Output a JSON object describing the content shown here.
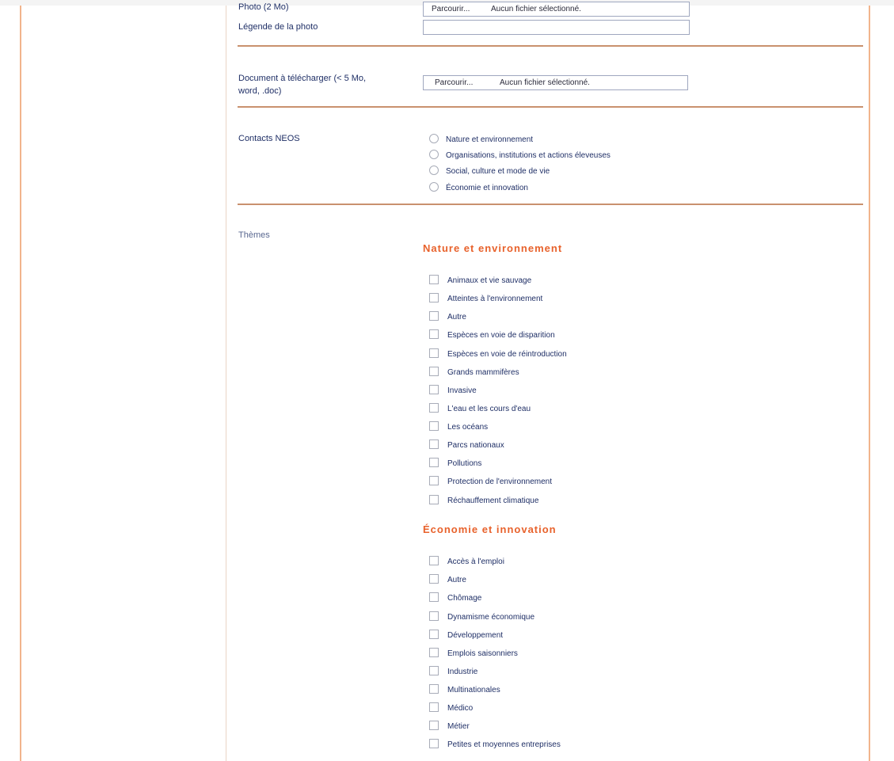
{
  "form": {
    "photo_label": "Photo (2 Mo)",
    "photo_browse": "Parcourir...",
    "photo_nofile": "Aucun fichier sélectionné.",
    "caption_label": "Légende de la photo",
    "caption_value": "",
    "doc_label_line1": "Document à télécharger (< 5 Mo,",
    "doc_label_line2": "word, .doc)",
    "doc_browse": "Parcourir...",
    "doc_nofile": "Aucun fichier sélectionné.",
    "contacts_label": "Contacts NEOS",
    "contacts_options": [
      "Nature et environnement",
      "Organisations, institutions et actions éleveuses",
      "Social, culture et mode de vie",
      "Économie et innovation"
    ],
    "themes_label": "Thèmes"
  },
  "themes": [
    {
      "title": "Nature et environnement",
      "items": [
        "Animaux et vie sauvage",
        "Atteintes à l'environnement",
        "Autre",
        "Espèces en voie de disparition",
        "Espèces en voie de réintroduction",
        "Grands mammifères",
        "Invasive",
        "L'eau et les cours d'eau",
        "Les océans",
        "Parcs nationaux",
        "Pollutions",
        "Protection de l'environnement",
        "Réchauffement climatique"
      ]
    },
    {
      "title": "Économie et innovation",
      "items": [
        "Accès à l'emploi",
        "Autre",
        "Chômage",
        "Dynamisme économique",
        "Développement",
        "Emplois saisonniers",
        "Industrie",
        "Multinationales",
        "Médico",
        "Métier",
        "Petites et moyennes entreprises"
      ]
    }
  ],
  "colors": {
    "accent": "#e8622c",
    "label_text": "#1f2f66",
    "separator": "#c9916e",
    "frame": "#f1b48c"
  }
}
